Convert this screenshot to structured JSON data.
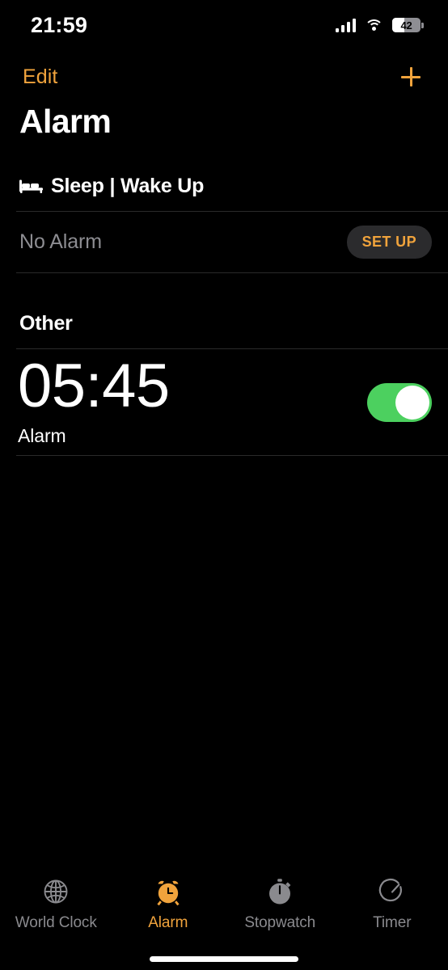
{
  "status_bar": {
    "time": "21:59",
    "battery_percent": "42",
    "battery_level": 42,
    "signal_icon": "cellular-signal-icon",
    "wifi_icon": "wifi-icon",
    "battery_icon": "battery-icon"
  },
  "nav": {
    "edit_label": "Edit",
    "add_icon": "plus-icon",
    "accent_color": "#F0A33C"
  },
  "page_title": "Alarm",
  "sleep_section": {
    "icon": "bed-icon",
    "title": "Sleep | Wake Up",
    "status_text": "No Alarm",
    "setup_label": "SET UP"
  },
  "other_section": {
    "title": "Other",
    "alarms": [
      {
        "time": "05:45",
        "label": "Alarm",
        "enabled": true,
        "toggle_color": "#4CD05F"
      }
    ]
  },
  "tab_bar": {
    "active_index": 1,
    "tabs": [
      {
        "label": "World Clock",
        "icon": "globe-icon"
      },
      {
        "label": "Alarm",
        "icon": "alarm-clock-icon"
      },
      {
        "label": "Stopwatch",
        "icon": "stopwatch-icon"
      },
      {
        "label": "Timer",
        "icon": "timer-icon"
      }
    ]
  },
  "colors": {
    "background": "#000000",
    "accent": "#F0A33C",
    "toggle_on": "#4CD05F",
    "secondary_text": "#8D8D92",
    "divider": "#2A2A2A"
  }
}
